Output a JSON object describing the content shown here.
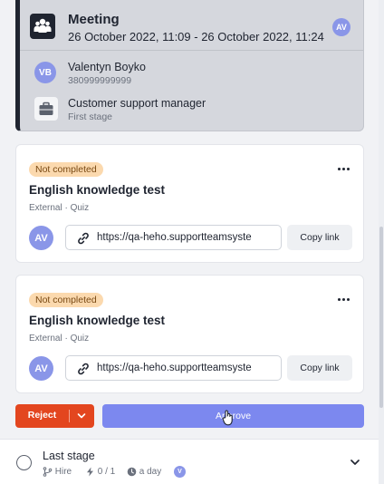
{
  "meeting": {
    "title": "Meeting",
    "time": "26 October 2022, 11:09 - 26 October 2022, 11:24",
    "assignee_initials": "AV",
    "icon": "people-icon"
  },
  "candidate": {
    "initials": "VB",
    "name": "Valentyn Boyko",
    "phone": "380999999999"
  },
  "job": {
    "title": "Customer support manager",
    "stage": "First stage",
    "icon": "briefcase-icon"
  },
  "tests": [
    {
      "status": "Not completed",
      "title": "English knowledge test",
      "subtitle": "External · Quiz",
      "assignee_initials": "AV",
      "link": "https://qa-heho.supportteamsyste",
      "copy_label": "Copy link"
    },
    {
      "status": "Not completed",
      "title": "English knowledge test",
      "subtitle": "External · Quiz",
      "assignee_initials": "AV",
      "link": "https://qa-heho.supportteamsyste",
      "copy_label": "Copy link"
    }
  ],
  "actions": {
    "reject_label": "Reject",
    "approve_label": "Approve"
  },
  "last_stage": {
    "title": "Last stage",
    "type": "Hire",
    "progress": "0 / 1",
    "duration": "a day",
    "assignee_initial": "V"
  },
  "colors": {
    "reject": "#e3461f",
    "approve": "#7c88ef",
    "badge_bg": "#fbd9ae",
    "avatar": "#8a96e8",
    "meeting_bg": "#d5d7dd"
  }
}
